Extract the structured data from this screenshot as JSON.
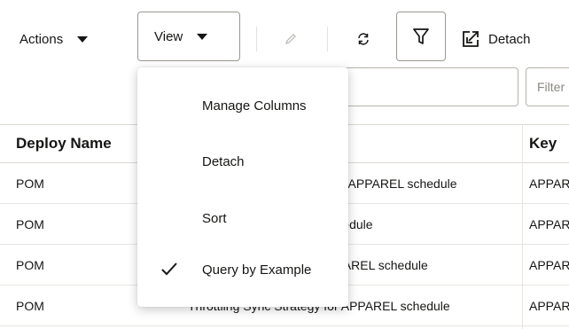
{
  "toolbar": {
    "actions_label": "Actions",
    "view_label": "View",
    "detach_label": "Detach",
    "icons": [
      "chevron-down-icon",
      "pencil-icon",
      "refresh-icon",
      "filter-icon",
      "detach-icon"
    ]
  },
  "filters": {
    "key_placeholder": "Filter"
  },
  "table": {
    "columns": [
      "Deploy Name",
      "",
      "Key"
    ],
    "rows": [
      {
        "name": "POM",
        "description": "Enable Background Sync for APPAREL schedule",
        "key": "APPAREL"
      },
      {
        "name": "POM",
        "description": "Sync Flag for APPAREL schedule",
        "key": "APPAREL"
      },
      {
        "name": "POM",
        "description": "Throttling Sync Flag for APPAREL schedule",
        "key": "APPAREL"
      },
      {
        "name": "POM",
        "description": "Throttling Sync Strategy for APPAREL schedule",
        "key": "APPAREL"
      }
    ]
  },
  "menu": {
    "items": [
      {
        "label": "Manage Columns",
        "checked": false
      },
      {
        "label": "Detach",
        "checked": false
      },
      {
        "label": "Sort",
        "checked": false
      },
      {
        "label": "Query by Example",
        "checked": true
      }
    ]
  },
  "colors": {
    "text": "#161513",
    "border": "#9c9892",
    "divider": "#e8e5e1"
  }
}
